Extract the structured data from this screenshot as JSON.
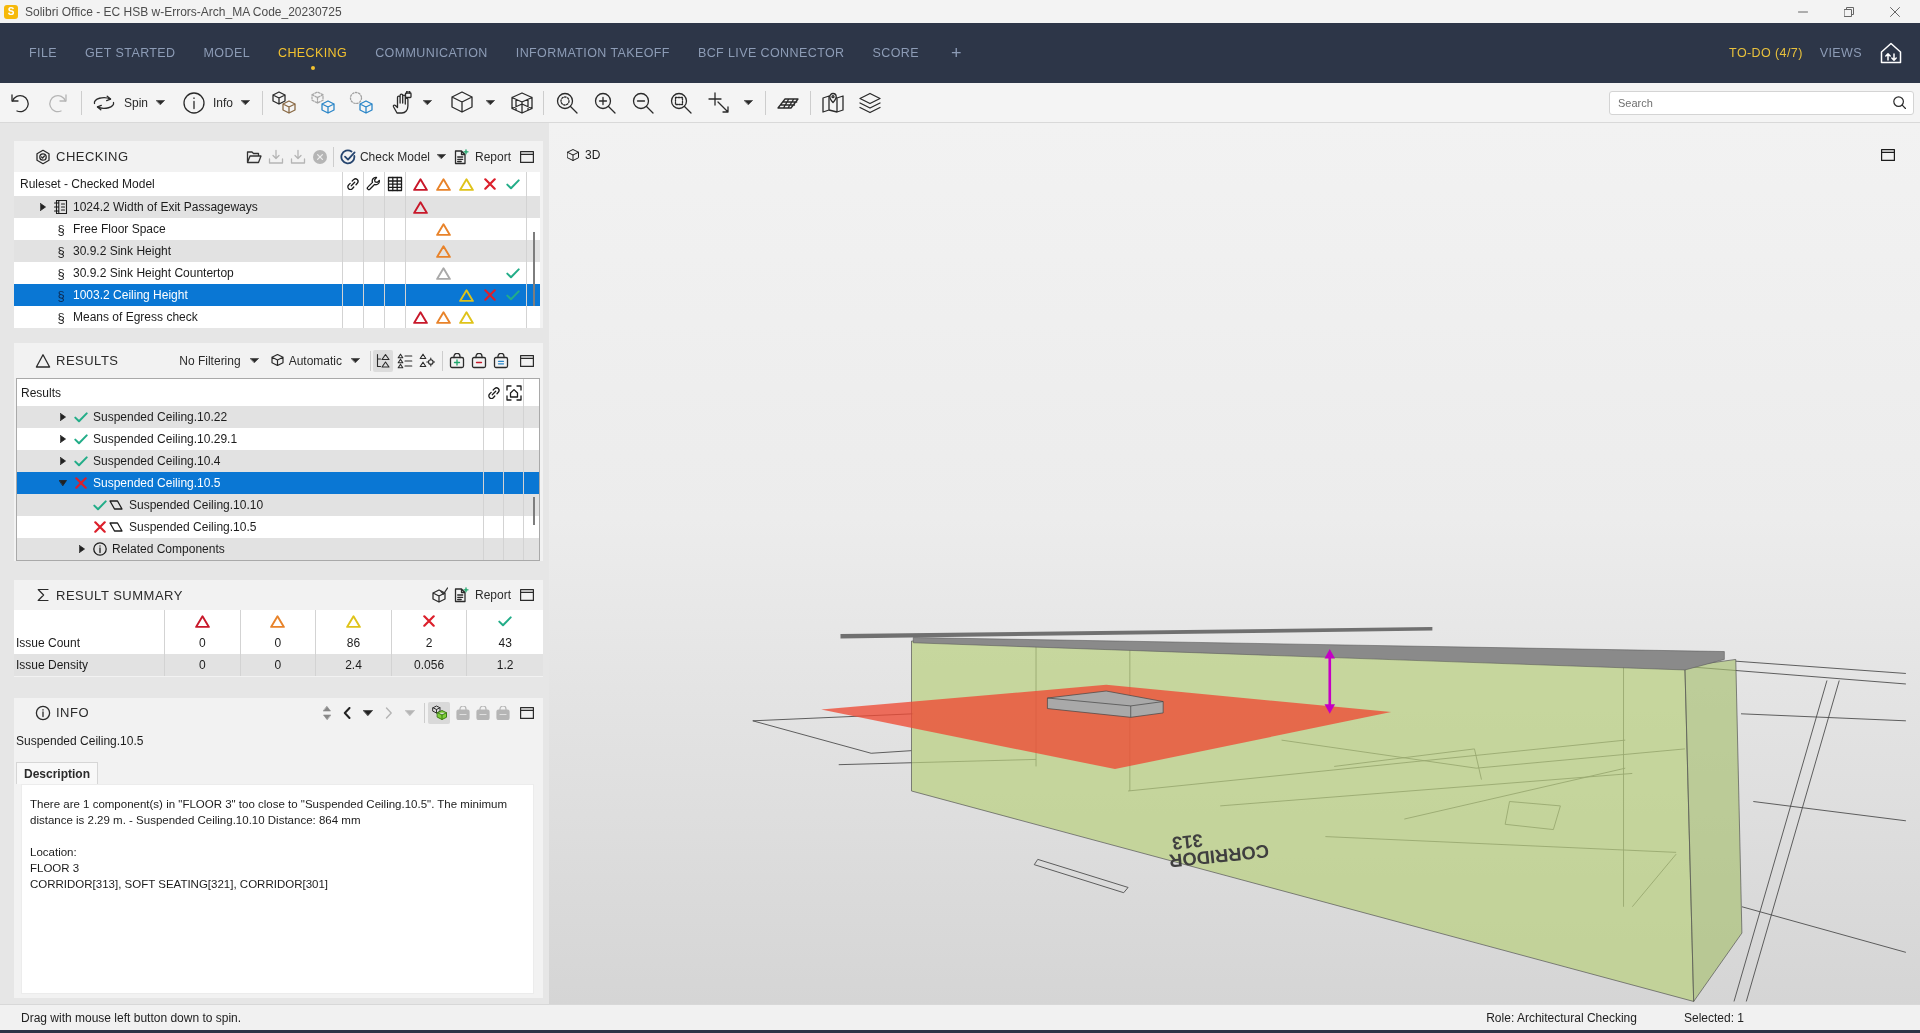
{
  "window": {
    "logo": "S",
    "title": "Solibri Office - EC HSB w-Errors-Arch_MA Code_20230725"
  },
  "nav": {
    "tabs": [
      {
        "label": "FILE",
        "selected": false
      },
      {
        "label": "GET STARTED",
        "selected": false
      },
      {
        "label": "MODEL",
        "selected": false
      },
      {
        "label": "CHECKING",
        "selected": true
      },
      {
        "label": "COMMUNICATION",
        "selected": false
      },
      {
        "label": "INFORMATION TAKEOFF",
        "selected": false
      },
      {
        "label": "BCF LIVE CONNECTOR",
        "selected": false
      },
      {
        "label": "SCORE",
        "selected": false
      }
    ],
    "add_tab": "+",
    "right_links": [
      {
        "label": "TO-DO (4/7)",
        "highlighted": true
      },
      {
        "label": "VIEWS",
        "highlighted": false
      }
    ]
  },
  "toolbar": {
    "undo_disabled": false,
    "redo_disabled": true,
    "spin_label": "Spin",
    "info_label": "Info",
    "search": {
      "placeholder": "Search"
    }
  },
  "checking": {
    "title": "CHECKING",
    "tools": [
      {
        "kind": "open",
        "disabled": false
      },
      {
        "kind": "import",
        "disabled": true
      },
      {
        "kind": "export",
        "disabled": true
      },
      {
        "kind": "stop",
        "disabled": true
      }
    ],
    "check_model_label": "Check Model",
    "report_label": "Report",
    "tree_header": "Ruleset - Checked Model",
    "rules": [
      {
        "kind": "ruleset",
        "label": "1024.2 Width of Exit Passageways",
        "expanded": false,
        "selected": false,
        "marks": [
          {
            "kind": "high",
            "shown": true
          },
          {
            "kind": "medium",
            "shown": false
          },
          {
            "kind": "low",
            "shown": false
          },
          {
            "kind": "rejected",
            "shown": false
          },
          {
            "kind": "accepted",
            "shown": false
          }
        ]
      },
      {
        "kind": "rule",
        "symbol": "§",
        "label": "Free Floor Space",
        "selected": false,
        "marks": [
          {
            "kind": "high",
            "shown": false
          },
          {
            "kind": "medium",
            "shown": true
          },
          {
            "kind": "low",
            "shown": false
          },
          {
            "kind": "rejected",
            "shown": false
          },
          {
            "kind": "accepted",
            "shown": false
          }
        ]
      },
      {
        "kind": "rule",
        "symbol": "§",
        "label": "30.9.2 Sink Height",
        "selected": false,
        "marks": [
          {
            "kind": "high",
            "shown": false
          },
          {
            "kind": "medium",
            "shown": true
          },
          {
            "kind": "low",
            "shown": false
          },
          {
            "kind": "rejected",
            "shown": false
          },
          {
            "kind": "accepted",
            "shown": false
          }
        ]
      },
      {
        "kind": "rule",
        "symbol": "§",
        "label": "30.9.2 Sink Height Countertop",
        "selected": false,
        "marks": [
          {
            "kind": "high",
            "shown": false
          },
          {
            "kind": "muted",
            "shown": true
          },
          {
            "kind": "low",
            "shown": false
          },
          {
            "kind": "rejected",
            "shown": false
          },
          {
            "kind": "accepted",
            "shown": true
          }
        ]
      },
      {
        "kind": "rule",
        "symbol": "§",
        "label": "1003.2 Ceiling Height",
        "selected": true,
        "marks": [
          {
            "kind": "high",
            "shown": false
          },
          {
            "kind": "medium",
            "shown": false
          },
          {
            "kind": "low",
            "shown": true
          },
          {
            "kind": "rejected",
            "shown": true
          },
          {
            "kind": "accepted",
            "shown": true
          }
        ]
      },
      {
        "kind": "rule",
        "symbol": "§",
        "label": "Means of Egress check",
        "selected": false,
        "marks": [
          {
            "kind": "high",
            "shown": true
          },
          {
            "kind": "medium",
            "shown": true
          },
          {
            "kind": "low",
            "shown": true
          },
          {
            "kind": "rejected",
            "shown": false
          },
          {
            "kind": "accepted",
            "shown": false
          }
        ]
      }
    ]
  },
  "results": {
    "title": "RESULTS",
    "filter_label": "No Filtering",
    "mode_label": "Automatic",
    "view_modes": [
      {
        "kind": "tree",
        "selected": true
      },
      {
        "kind": "list",
        "selected": false
      },
      {
        "kind": "settings",
        "selected": false
      }
    ],
    "tree_header": "Results",
    "items": [
      {
        "kind": "result",
        "passed": true,
        "label": "Suspended Ceiling.10.22",
        "expanded": false,
        "selected": false
      },
      {
        "kind": "result",
        "passed": true,
        "label": "Suspended Ceiling.10.29.1",
        "expanded": false,
        "selected": false
      },
      {
        "kind": "result",
        "passed": true,
        "label": "Suspended Ceiling.10.4",
        "expanded": false,
        "selected": false
      },
      {
        "kind": "result",
        "passed": false,
        "label": "Suspended Ceiling.10.5",
        "expanded": true,
        "selected": true,
        "children": [
          {
            "kind": "component",
            "passed": true,
            "label": "Suspended Ceiling.10.10",
            "selected": false
          },
          {
            "kind": "component",
            "passed": false,
            "label": "Suspended Ceiling.10.5",
            "selected": false
          },
          {
            "kind": "group",
            "label": "Related Components",
            "expanded": false,
            "selected": false
          }
        ]
      }
    ]
  },
  "result_summary": {
    "title": "RESULT SUMMARY",
    "report_label": "Report",
    "rows": [
      {
        "label": "Issue Count",
        "values": [
          "0",
          "0",
          "86",
          "2",
          "43"
        ]
      },
      {
        "label": "Issue Density",
        "values": [
          "0",
          "0",
          "2.4",
          "0.056",
          "1.2"
        ]
      }
    ]
  },
  "info": {
    "title": "INFO",
    "previous_disabled": false,
    "next_disabled": true,
    "highlight_on": true,
    "basket_disabled": true,
    "subject": "Suspended Ceiling.10.5",
    "tabs": [
      {
        "label": "Description",
        "selected": true
      }
    ],
    "description": "There are 1 component(s) in \"FLOOR 3\" too close to \"Suspended Ceiling.10.5\". The minimum distance is 2.29 m. - Suspended Ceiling.10.10 Distance: 864 mm",
    "location_lines": [
      "Location:",
      "FLOOR 3",
      "CORRIDOR[313], SOFT SEATING[321], CORRIDOR[301]"
    ]
  },
  "viewport": {
    "title": "3D",
    "room_label": [
      "CORRIDOR",
      "313"
    ]
  },
  "status_bar": {
    "hint": "Drag with mouse left button down to spin.",
    "role": "Role: Architectural Checking",
    "selection": "Selected: 1"
  }
}
